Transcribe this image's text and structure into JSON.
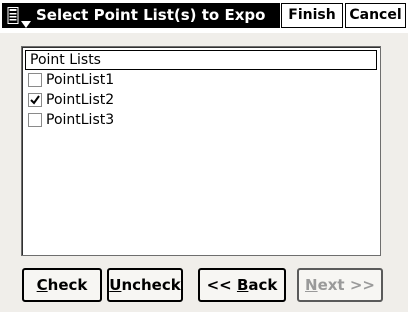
{
  "window": {
    "title": "Select Point List(s) to Expo",
    "finish_label": "Finish",
    "cancel_label": "Cancel"
  },
  "list": {
    "header": "Point Lists",
    "items": [
      {
        "label": "PointList1",
        "checked": false
      },
      {
        "label": "PointList2",
        "checked": true
      },
      {
        "label": "PointList3",
        "checked": false
      }
    ]
  },
  "buttons": {
    "check": {
      "hotkey": "C",
      "rest": "heck"
    },
    "uncheck": {
      "hotkey": "U",
      "rest": "ncheck"
    },
    "back": {
      "prefix": "<< ",
      "hotkey": "B",
      "rest": "ack"
    },
    "next": {
      "hotkey": "N",
      "rest": "ext >>",
      "enabled": false
    }
  }
}
